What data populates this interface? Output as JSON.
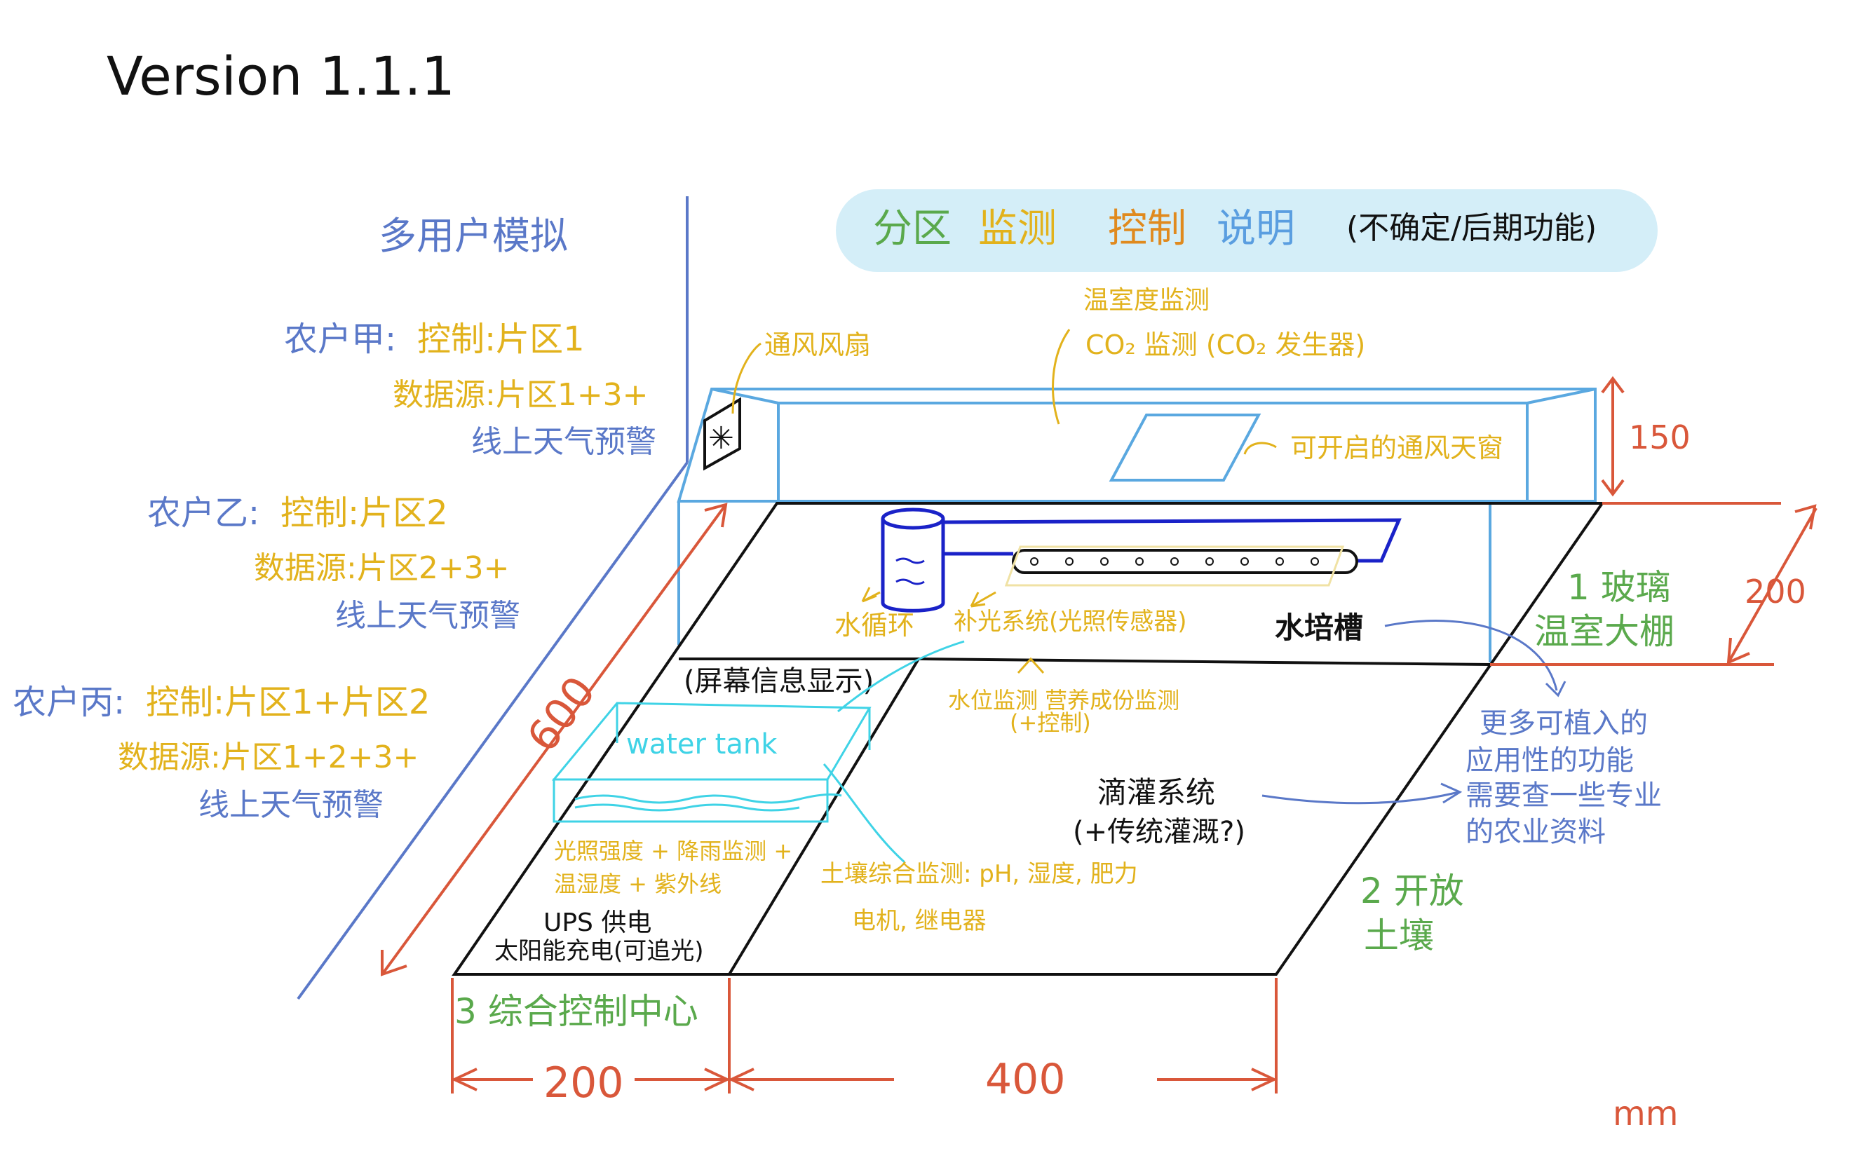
{
  "version": "Version 1.1.1",
  "banner": {
    "zone": "分区",
    "monitor": "监测",
    "control": "控制",
    "explain": "说明",
    "note": "(不确定/后期功能)"
  },
  "users": {
    "heading": "多用户模拟",
    "farmer_a": {
      "name": "农户甲:",
      "control": "控制:片区1",
      "source": "数据源:片区1+3+",
      "weather": "线上天气预警"
    },
    "farmer_b": {
      "name": "农户乙:",
      "control": "控制:片区2",
      "source": "数据源:片区2+3+",
      "weather": "线上天气预警"
    },
    "farmer_c": {
      "name": "农户丙:",
      "control": "控制:片区1+片区2",
      "source": "数据源:片区1+2+3+",
      "weather": "线上天气预警"
    }
  },
  "greenhouse": {
    "fan": "通风风扇",
    "temperature": "温室度监测",
    "co2": "CO₂ 监测 (CO₂ 发生器)",
    "skylight": "可开启的通风天窗",
    "water_cycle": "水循环",
    "grow_light": "补光系统(光照传感器)",
    "hydro_tank": "水培槽",
    "water_level": "水位监测 营养成份监测",
    "plus_control": "(+控制)",
    "label_line1": "1 玻璃",
    "label_line2": "温室大棚"
  },
  "control_center": {
    "screen": "(屏幕信息显示)",
    "water_tank": "water tank",
    "sensors_line1": "光照强度 + 降雨监测 +",
    "sensors_line2": "温湿度 + 紫外线",
    "ups": "UPS 供电",
    "solar": "太阳能充电(可追光)",
    "label": "3 综合控制中心"
  },
  "open_field": {
    "soil_monitor": "土壤综合监测: pH, 湿度, 肥力",
    "motor": "电机, 继电器",
    "drip": "滴灌系统",
    "drip_extra": "(+传统灌溉?)",
    "label_line1": "2 开放",
    "label_line2": "土壤"
  },
  "future": {
    "line1": "更多可植入的",
    "line2": "应用性的功能",
    "line3": "需要查一些专业",
    "line4": "的农业资料"
  },
  "dimensions": {
    "height_small": "150",
    "height_large": "200",
    "depth": "600",
    "width_left": "200",
    "width_right": "400",
    "unit": "mm"
  },
  "colors": {
    "blue": "#5a78c8",
    "yellow": "#e2b21c",
    "green": "#5aa94c",
    "red": "#d9573a",
    "cyan": "#3fd3e6",
    "sky": "#5aa8e0",
    "banner_bg": "#d4eef8"
  }
}
